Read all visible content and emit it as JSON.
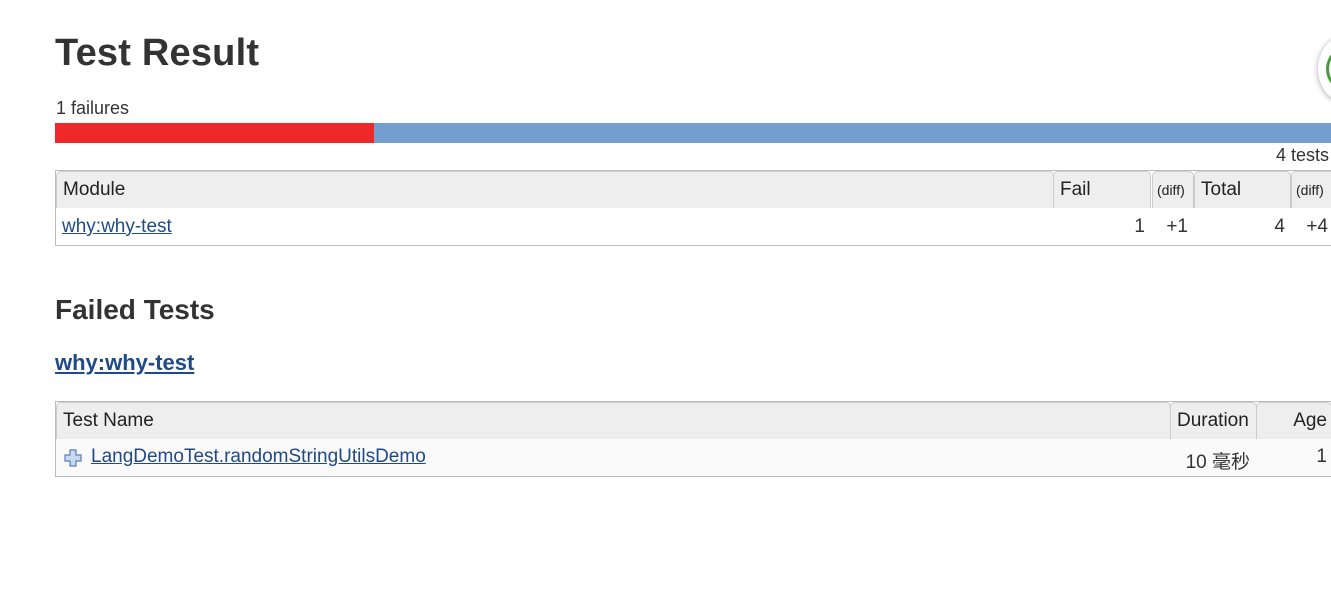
{
  "header": {
    "title": "Test Result",
    "failures_text": "1 failures",
    "tests_text": "4 tests",
    "fail_fraction": 0.25
  },
  "colors": {
    "fail": "#ef2929",
    "pass": "#729fcf",
    "link": "#204a87"
  },
  "module_table": {
    "headers": {
      "module": "Module",
      "fail": "Fail",
      "fail_diff": "(diff)",
      "total": "Total",
      "total_diff": "(diff)"
    },
    "rows": [
      {
        "module": "why:why-test",
        "fail": "1",
        "fail_diff": "+1",
        "total": "4",
        "total_diff": "+4"
      }
    ]
  },
  "failed_tests": {
    "title": "Failed Tests",
    "module_heading": "why:why-test",
    "headers": {
      "test_name": "Test Name",
      "duration": "Duration",
      "age": "Age"
    },
    "rows": [
      {
        "icon": "expand-plus-icon",
        "test_name": "LangDemoTest.randomStringUtilsDemo",
        "duration": "10 毫秒",
        "age": "1"
      }
    ]
  }
}
